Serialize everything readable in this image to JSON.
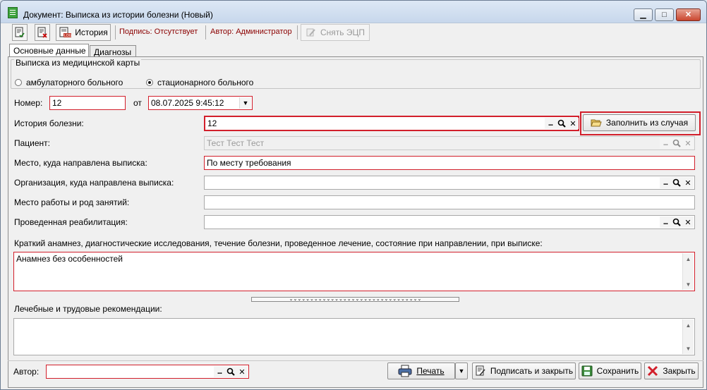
{
  "window": {
    "title": "Документ: Выписка из истории болезни (Новый)",
    "controls": {
      "minimize": "▁",
      "maximize": "□",
      "close": "✕"
    }
  },
  "toolbar": {
    "history_label": "История",
    "signature_label": "Подпись: Отсутствует",
    "author_label": "Автор: Администратор",
    "remove_ecp_label": "Снять ЭЦП"
  },
  "tabs": [
    "Основные данные",
    "Диагнозы"
  ],
  "card_group": {
    "title": "Выписка из медицинской карты",
    "options": [
      {
        "label": "амбулаторного больного",
        "selected": false
      },
      {
        "label": "стационарного больного",
        "selected": true
      }
    ]
  },
  "form": {
    "number_label": "Номер:",
    "number_value": "12",
    "from_label": "от",
    "date_value": "08.07.2025 9:45:12",
    "history_label": "История болезни:",
    "history_value": "12",
    "fill_button": "Заполнить из случая",
    "patient_label": "Пациент:",
    "patient_value": "Тест Тест Тест",
    "place_label": "Место, куда направлена выписка:",
    "place_value": "По месту требования",
    "org_label": "Организация, куда направлена выписка:",
    "org_value": "",
    "work_label": "Место работы и род занятий:",
    "work_value": "",
    "rehab_label": "Проведенная реабилитация:",
    "rehab_value": "",
    "anamnesis_label": "Краткий анамнез, диагностические исследования, течение болезни, проведенное лечение, состояние при направлении, при выписке:",
    "anamnesis_value": "Анамнез без особенностей",
    "recommendations_label": "Лечебные и трудовые рекомендации:",
    "recommendations_value": ""
  },
  "footer": {
    "author_label": "Автор:",
    "author_value": "",
    "print_button": "Печать",
    "sign_close_button": "Подписать и закрыть",
    "save_button": "Сохранить",
    "close_button": "Закрыть"
  },
  "icons": {
    "lookup": "...",
    "search": "search-icon",
    "clear": "✕",
    "dropdown": "▼",
    "scroll_up": "▲",
    "scroll_down": "▼",
    "splitter": "⌄⌄⌄⌄⌄⌄⌄⌄⌄⌄⌄⌄⌄⌄⌄⌄⌄⌄⌄⌄⌄⌄⌄⌄⌄⌄⌄⌄⌄⌄⌄⌄"
  },
  "colors": {
    "required_border": "#d21f2b",
    "toolbar_status_text": "#8b0000",
    "disabled_text": "#9a9a9a"
  }
}
